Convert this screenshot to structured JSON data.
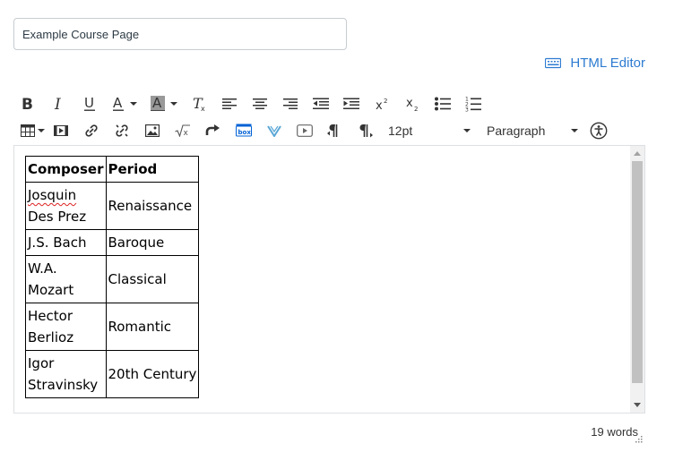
{
  "title_field": {
    "value": "Example Course Page"
  },
  "html_editor": {
    "label": "HTML Editor"
  },
  "toolbar": {
    "font_size": "12pt",
    "block_format": "Paragraph",
    "superscript_label": "x²",
    "subscript_label": "x₂"
  },
  "table": {
    "headers": [
      "Composer",
      "Period"
    ],
    "rows": [
      {
        "composer_line1": "Josquin",
        "composer_line2": "Des Prez",
        "period": "Renaissance"
      },
      {
        "composer_line1": "J.S. Bach",
        "composer_line2": "",
        "period": "Baroque"
      },
      {
        "composer_line1": "W.A.",
        "composer_line2": "Mozart",
        "period": "Classical"
      },
      {
        "composer_line1": "Hector",
        "composer_line2": "Berlioz",
        "period": "Romantic"
      },
      {
        "composer_line1": "Igor",
        "composer_line2": "Stravinsky",
        "period": "20th Century"
      }
    ]
  },
  "status": {
    "word_count": "19 words"
  },
  "colors": {
    "link": "#2d7bd1",
    "border": "#c7cdd1",
    "text": "#2d3b45"
  }
}
